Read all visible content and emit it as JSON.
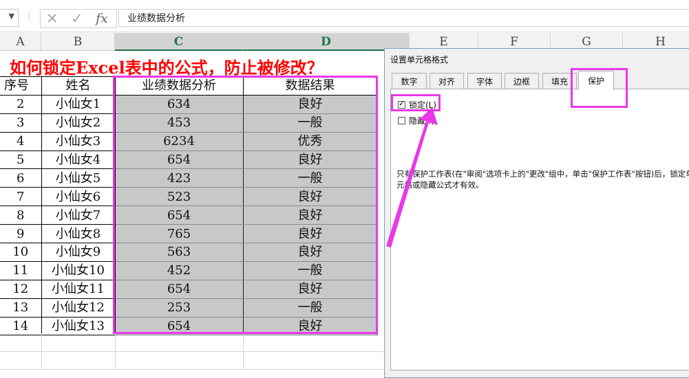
{
  "formula_bar": {
    "namebox_arrow": "▼",
    "dots": "⋮",
    "cancel_icon": "✕",
    "enter_icon": "✓",
    "fx": "fx",
    "value": "业绩数据分析"
  },
  "columns": [
    "A",
    "B",
    "C",
    "D",
    "E",
    "F",
    "G",
    "H"
  ],
  "title": "如何锁定Excel表中的公式，防止被修改？",
  "table": {
    "headers": [
      "序号",
      "姓名",
      "业绩数据分析",
      "数据结果"
    ],
    "rows": [
      [
        "2",
        "小仙女1",
        "634",
        "良好"
      ],
      [
        "3",
        "小仙女2",
        "453",
        "一般"
      ],
      [
        "4",
        "小仙女3",
        "6234",
        "优秀"
      ],
      [
        "5",
        "小仙女4",
        "654",
        "良好"
      ],
      [
        "6",
        "小仙女5",
        "423",
        "一般"
      ],
      [
        "7",
        "小仙女6",
        "523",
        "良好"
      ],
      [
        "8",
        "小仙女7",
        "654",
        "良好"
      ],
      [
        "9",
        "小仙女8",
        "765",
        "良好"
      ],
      [
        "10",
        "小仙女9",
        "563",
        "良好"
      ],
      [
        "11",
        "小仙女10",
        "452",
        "一般"
      ],
      [
        "12",
        "小仙女11",
        "654",
        "良好"
      ],
      [
        "13",
        "小仙女12",
        "253",
        "一般"
      ],
      [
        "14",
        "小仙女13",
        "654",
        "良好"
      ]
    ]
  },
  "dialog": {
    "title": "设置单元格格式",
    "tabs": [
      "数字",
      "对齐",
      "字体",
      "边框",
      "填充",
      "保护"
    ],
    "active_tab": "保护",
    "locked_label": "锁定(L)",
    "locked_checked": true,
    "hidden_label": "隐藏(I)",
    "hidden_checked": false,
    "note": "只有保护工作表(在\"审阅\"选项卡上的\"更改\"组中，单击\"保护工作表\"按钮)后，锁定单元格或隐藏公式才有效。"
  },
  "colors": {
    "highlight": "#e838e8",
    "title": "#ff0000",
    "selected_fill": "#c8c8c8",
    "excel_green": "#217346"
  }
}
